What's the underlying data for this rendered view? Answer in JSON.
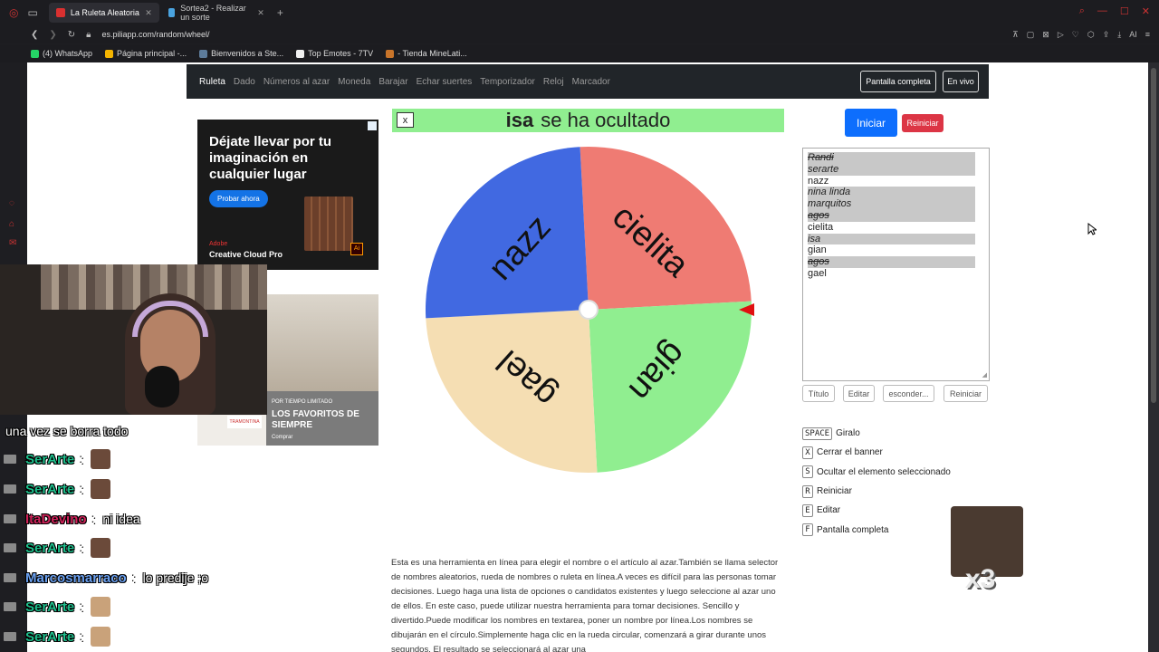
{
  "browser": {
    "tabs": [
      {
        "title": "La Ruleta Aleatoria",
        "active": true,
        "favicon_color": "#d93030"
      },
      {
        "title": "Sortea2 - Realizar un sorte",
        "active": false,
        "favicon_color": "#4aa3df"
      }
    ],
    "url": "es.piliapp.com/random/wheel/",
    "bookmarks": [
      {
        "label": "(4) WhatsApp",
        "color": "#25d366"
      },
      {
        "label": "Página principal -...",
        "color": "#f4b400"
      },
      {
        "label": "Bienvenidos a Ste...",
        "color": "#1b2838"
      },
      {
        "label": "Top Emotes - 7TV",
        "color": "#f0f0f0"
      },
      {
        "label": "- Tienda MineLati...",
        "color": "#c8742a"
      }
    ]
  },
  "nav": {
    "brand": "Ruleta",
    "links": [
      "Dado",
      "Números al azar",
      "Moneda",
      "Barajar",
      "Echar suertes",
      "Temporizador",
      "Reloj",
      "Marcador"
    ],
    "fullscreen": "Pantalla completa",
    "live": "En vivo"
  },
  "ads": {
    "ad1": {
      "headline": "Déjate llevar por tu imaginación en cualquier lugar",
      "cta": "Probar ahora",
      "logo": "Adobe",
      "product": "Creative Cloud Pro",
      "app_mark": "Ai"
    },
    "ad2": {
      "small": "POR TIEMPO LIMITADO",
      "headline": "LOS FAVORITOS DE SIEMPRE",
      "cta": "Comprar",
      "brand": "TRAMONTINA"
    }
  },
  "banner": {
    "close": "x",
    "name": "isa",
    "message": "se ha ocultado"
  },
  "wheel": {
    "segments": [
      {
        "label": "cielita",
        "color": "#ef7b73"
      },
      {
        "label": "gian",
        "color": "#90ee90"
      },
      {
        "label": "gael",
        "color": "#f5deb3"
      },
      {
        "label": "nazz",
        "color": "#4169e1"
      }
    ],
    "pointer_color": "#e01010"
  },
  "controls": {
    "start": "Iniciar",
    "reset": "Reiniciar"
  },
  "names": [
    {
      "text": "Randi",
      "hidden": true,
      "strike": true
    },
    {
      "text": "serarte",
      "hidden": true,
      "strike": false
    },
    {
      "text": "nazz",
      "hidden": false,
      "strike": false
    },
    {
      "text": "nina linda",
      "hidden": true,
      "strike": false
    },
    {
      "text": "marquitos",
      "hidden": true,
      "strike": false
    },
    {
      "text": "agos",
      "hidden": true,
      "strike": true
    },
    {
      "text": "cielita",
      "hidden": false,
      "strike": false
    },
    {
      "text": "isa",
      "hidden": true,
      "strike": false
    },
    {
      "text": "gian",
      "hidden": false,
      "strike": false
    },
    {
      "text": "agos",
      "hidden": true,
      "strike": true
    },
    {
      "text": "gael",
      "hidden": false,
      "strike": false
    }
  ],
  "list_buttons": [
    "Título",
    "Editar",
    "esconder...",
    "Reiniciar"
  ],
  "shortcuts": [
    {
      "key": "SPACE",
      "label": "Giralo"
    },
    {
      "key": "X",
      "label": "Cerrar el banner"
    },
    {
      "key": "S",
      "label": "Ocultar el elemento seleccionado"
    },
    {
      "key": "R",
      "label": "Reiniciar"
    },
    {
      "key": "E",
      "label": "Editar"
    },
    {
      "key": "F",
      "label": "Pantalla completa"
    }
  ],
  "description": "Esta es una herramienta en línea para elegir el nombre o el artículo al azar.También se llama selector de nombres aleatorios, rueda de nombres o ruleta en línea.A veces es difícil para las personas tomar decisiones. Luego haga una lista de opciones o candidatos existentes y luego seleccione al azar uno de ellos. En este caso, puede utilizar nuestra herramienta para tomar decisiones. Sencillo y divertido.Puede modificar los nombres en textarea, poner un nombre por línea.Los nombres se dibujarán en el círculo.Simplemente haga clic en la rueda circular, comenzará a girar durante unos segundos. El resultado se seleccionará al azar una",
  "stream": {
    "caption": "una vez se borra todo",
    "chat": [
      {
        "user": "SerArte",
        "color": "#1dbf8c",
        "text": "",
        "emote": "#6b4a3a"
      },
      {
        "user": "SerArte",
        "color": "#1dbf8c",
        "text": "",
        "emote": "#6b4a3a"
      },
      {
        "user": "ItaDevino",
        "color": "#d0225a",
        "text": "ni idea",
        "emote": ""
      },
      {
        "user": "SerArte",
        "color": "#1dbf8c",
        "text": "",
        "emote": "#6b4a3a"
      },
      {
        "user": "Marcosmarraco",
        "color": "#6aa0f0",
        "text": "lo predije ;o",
        "emote": ""
      },
      {
        "user": "SerArte",
        "color": "#1dbf8c",
        "text": "",
        "emote": "#c9a27a"
      },
      {
        "user": "SerArte",
        "color": "#1dbf8c",
        "text": "",
        "emote": "#c9a27a"
      }
    ],
    "chat_separator": ":",
    "meme_count": "x3"
  }
}
